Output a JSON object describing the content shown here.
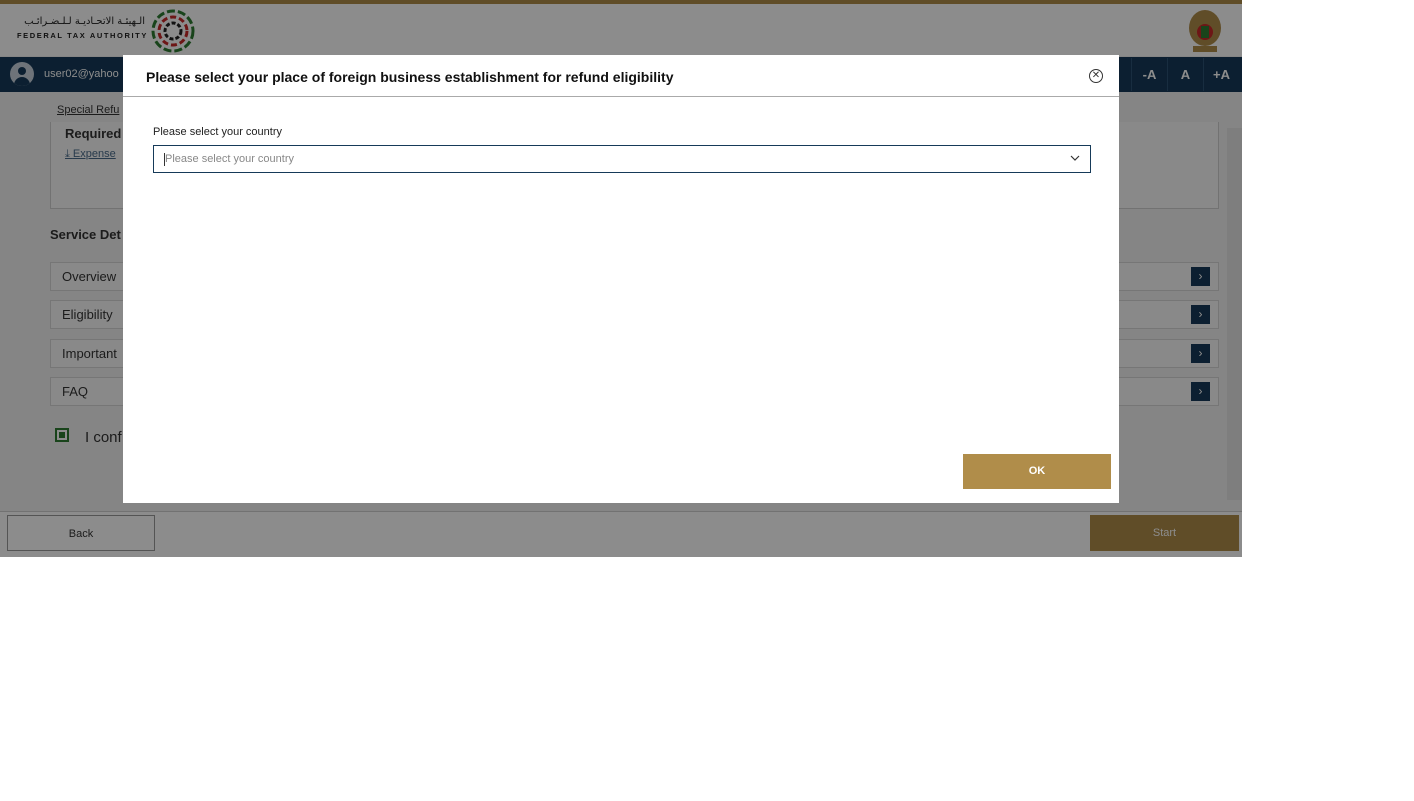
{
  "header": {
    "logo_arabic": "الـهيئـة الاتحـاديـة لـلـضـرائـب",
    "logo_english": "FEDERAL TAX AUTHORITY",
    "user_email": "user02@yahoo",
    "font_buttons": [
      "-A",
      "A",
      "+A"
    ]
  },
  "breadcrumb": {
    "label": "Special Refu"
  },
  "required_section": {
    "title": "Required",
    "link": "Expense"
  },
  "service_details": {
    "title": "Service Det",
    "accordions": [
      {
        "label": "Overview"
      },
      {
        "label": "Eligibility"
      },
      {
        "label": "Important"
      },
      {
        "label": "FAQ"
      }
    ]
  },
  "confirm": {
    "text": "I conf",
    "checked": true
  },
  "footer": {
    "back_label": "Back",
    "start_label": "Start"
  },
  "modal": {
    "title": "Please select your place of foreign business establishment for refund eligibility",
    "close_icon": "⊗",
    "field_label": "Please select your country",
    "select_placeholder": "Please select your country",
    "ok_label": "OK"
  },
  "colors": {
    "brand_navy": "#163a59",
    "brand_gold": "#b08d4a",
    "confirm_green": "#2e7d32"
  },
  "icons": [
    "user-avatar-icon",
    "download-icon",
    "chevron-right-icon",
    "close-circle-icon",
    "chevron-down-icon"
  ]
}
